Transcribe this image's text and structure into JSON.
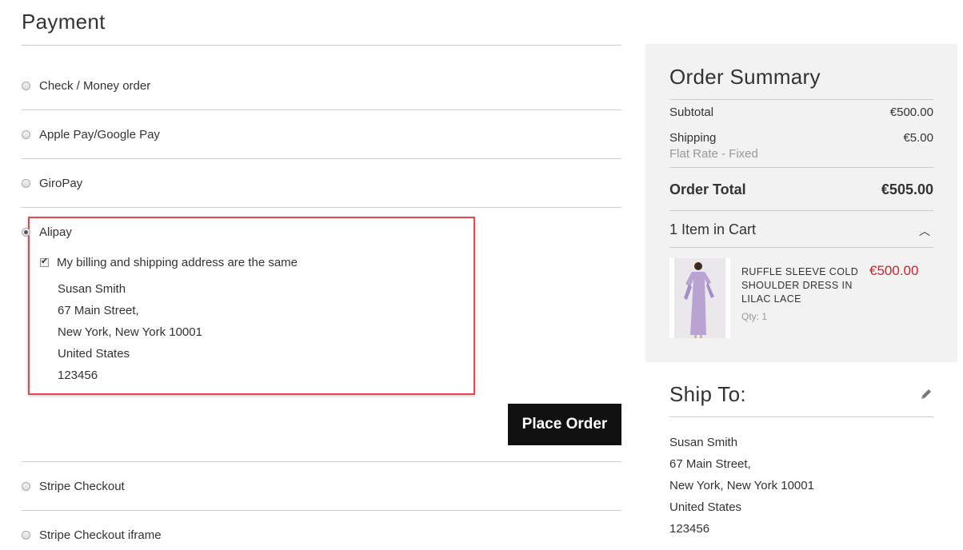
{
  "payment": {
    "title": "Payment",
    "methods": [
      {
        "label": "Check / Money order"
      },
      {
        "label": "Apple Pay/Google Pay"
      },
      {
        "label": "GiroPay"
      },
      {
        "label": "Alipay",
        "selected": true
      },
      {
        "label": "Stripe Checkout"
      },
      {
        "label": "Stripe Checkout iframe"
      }
    ],
    "same_address_label": "My billing and shipping address are the same",
    "billing_address": [
      "Susan Smith",
      "67 Main Street,",
      "New York, New York 10001",
      "United States",
      "123456"
    ],
    "place_order_label": "Place Order"
  },
  "summary": {
    "title": "Order Summary",
    "subtotal_label": "Subtotal",
    "subtotal_value": "€500.00",
    "shipping_label": "Shipping",
    "shipping_value": "€5.00",
    "shipping_method": "Flat Rate - Fixed",
    "total_label": "Order Total",
    "total_value": "€505.00",
    "cart_label": "1 Item in Cart",
    "item": {
      "name": "RUFFLE SLEEVE COLD SHOULDER DRESS IN LILAC LACE",
      "price": "€500.00",
      "qty": "Qty: 1"
    }
  },
  "ship_to": {
    "title": "Ship To:",
    "address": [
      "Susan Smith",
      "67 Main Street,",
      "New York, New York 10001",
      "United States",
      "123456"
    ]
  },
  "colors": {
    "accent_red": "#e8474d",
    "price_red": "#d0202a",
    "button_bg": "#111111",
    "summary_bg": "#f2f2f2"
  },
  "icons": [
    "chevron-up-icon",
    "pencil-icon"
  ]
}
